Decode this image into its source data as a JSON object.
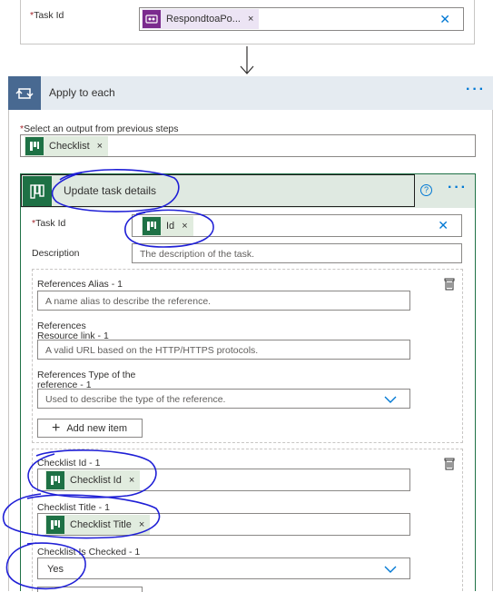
{
  "top_action": {
    "task_id_label": "Task Id",
    "task_id_token": "RespondtoaPo...",
    "clear_symbol": "✕"
  },
  "apply_to_each": {
    "title": "Apply to each",
    "more_symbol": "···",
    "select_output_label": "Select an output from previous steps",
    "checklist_token": "Checklist"
  },
  "update_task": {
    "title": "Update task details",
    "help_symbol": "?",
    "more_symbol": "···",
    "task_id_label": "Task Id",
    "task_id_token": "Id",
    "description_label": "Description",
    "description_placeholder": "The description of the task.",
    "references": {
      "alias_label": "References Alias - 1",
      "alias_placeholder": "A name alias to describe the reference.",
      "resource_label": "References Resource link - 1",
      "resource_placeholder": "A valid URL based on the HTTP/HTTPS protocols.",
      "type_label": "References Type of the reference - 1",
      "type_placeholder": "Used to describe the type of the reference.",
      "add_new_item": "Add new item"
    },
    "checklist": {
      "id_label": "Checklist Id - 1",
      "id_token": "Checklist Id",
      "title_label": "Checklist Title - 1",
      "title_token": "Checklist Title",
      "is_checked_label": "Checklist Is Checked - 1",
      "is_checked_value": "Yes"
    }
  },
  "token_remove_symbol": "×",
  "required_marker": "*"
}
